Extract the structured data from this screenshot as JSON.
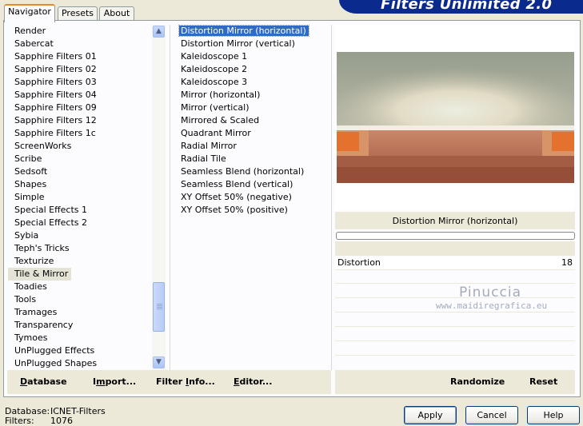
{
  "header": {
    "title": "Filters Unlimited 2.0"
  },
  "tabs": [
    {
      "label": "Navigator",
      "active": true
    },
    {
      "label": "Presets",
      "active": false
    },
    {
      "label": "About",
      "active": false
    }
  ],
  "categories": [
    "Render",
    "Sabercat",
    "Sapphire Filters 01",
    "Sapphire Filters 02",
    "Sapphire Filters 03",
    "Sapphire Filters 04",
    "Sapphire Filters 09",
    "Sapphire Filters 12",
    "Sapphire Filters 1c",
    "ScreenWorks",
    "Scribe",
    "Sedsoft",
    "Shapes",
    "Simple",
    "Special Effects 1",
    "Special Effects 2",
    "Sybia",
    "Teph's Tricks",
    "Texturize",
    "Tile & Mirror",
    "Toadies",
    "Tools",
    "Tramages",
    "Transparency",
    "Tymoes",
    "UnPlugged Effects",
    "UnPlugged Shapes"
  ],
  "selected_category": "Tile & Mirror",
  "filters": [
    "Distortion Mirror (horizontal)",
    "Distortion Mirror (vertical)",
    "Kaleidoscope 1",
    "Kaleidoscope 2",
    "Kaleidoscope 3",
    "Mirror (horizontal)",
    "Mirror (vertical)",
    "Mirrored & Scaled",
    "Quadrant Mirror",
    "Radial Mirror",
    "Radial Tile",
    "Seamless Blend (horizontal)",
    "Seamless Blend (vertical)",
    "XY Offset 50% (negative)",
    "XY Offset 50% (positive)"
  ],
  "selected_filter": "Distortion Mirror (horizontal)",
  "preview": {
    "filter_title": "Distortion Mirror (horizontal)"
  },
  "parameters": [
    {
      "label": "Distortion",
      "value": "18"
    }
  ],
  "watermark": {
    "line1": "Pinuccia",
    "line2": "www.maidiregrafica.eu"
  },
  "left_actions": [
    {
      "pre": "",
      "ul": "D",
      "post": "atabase"
    },
    {
      "pre": "I",
      "ul": "m",
      "post": "port..."
    },
    {
      "pre": "Filter ",
      "ul": "I",
      "post": "nfo..."
    },
    {
      "pre": "",
      "ul": "E",
      "post": "ditor..."
    }
  ],
  "right_actions": [
    {
      "label": "Randomize"
    },
    {
      "label": "Reset"
    }
  ],
  "footer": {
    "database_label": "Database:",
    "database_value": "ICNET-Filters",
    "filters_label": "Filters:",
    "filters_value": "1076"
  },
  "buttons": {
    "apply": "Apply",
    "cancel": "Cancel",
    "help": "Help"
  },
  "colors": {
    "banner": "#0a2a8e",
    "selection": "#316ac5",
    "window_bg": "#ece9d8"
  }
}
